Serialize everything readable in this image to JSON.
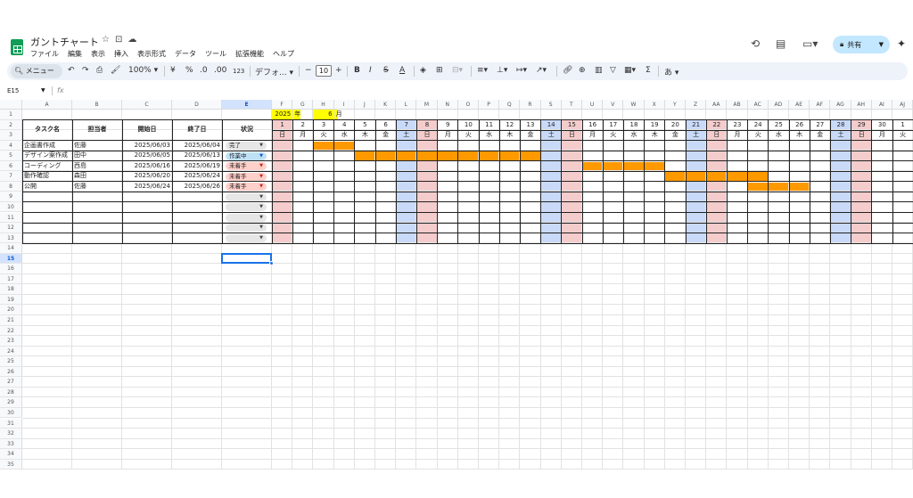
{
  "app": {
    "title": "ガントチャート",
    "menus": [
      "ファイル",
      "編集",
      "表示",
      "挿入",
      "表示形式",
      "データ",
      "ツール",
      "拡張機能",
      "ヘルプ"
    ],
    "share_label": "共有"
  },
  "toolbar": {
    "search_label": "メニュー",
    "zoom": "100%",
    "currency": "¥",
    "percent": "%",
    "dec_decrease": ".0",
    "dec_increase": ".00",
    "number_format": "123",
    "font": "デフォ...",
    "font_size": "10",
    "ime_label": "あ"
  },
  "formula_bar": {
    "name_box": "E15",
    "fx": "fx"
  },
  "columns": [
    "A",
    "B",
    "C",
    "D",
    "E",
    "F",
    "G",
    "H",
    "I",
    "J",
    "K",
    "L",
    "M",
    "N",
    "O",
    "P",
    "Q",
    "R",
    "S",
    "T",
    "U",
    "V",
    "W",
    "X",
    "Y",
    "Z",
    "AA",
    "AB",
    "AC",
    "AD",
    "AE",
    "AF",
    "AG",
    "AH",
    "AI",
    "AJ"
  ],
  "rows_count": 35,
  "selected": {
    "column": "E",
    "row": 15
  },
  "year_row": {
    "year": "2025",
    "year_label": "年",
    "month": "6",
    "month_label": "月"
  },
  "headers": {
    "task": "タスク名",
    "owner": "担当者",
    "start": "開始日",
    "end": "終了日",
    "status": "状況"
  },
  "days": [
    "1",
    "2",
    "3",
    "4",
    "5",
    "6",
    "7",
    "8",
    "9",
    "10",
    "11",
    "12",
    "13",
    "14",
    "15",
    "16",
    "17",
    "18",
    "19",
    "20",
    "21",
    "22",
    "23",
    "24",
    "25",
    "26",
    "27",
    "28",
    "29",
    "30",
    "1"
  ],
  "weekdays": [
    "日",
    "月",
    "火",
    "水",
    "木",
    "金",
    "土",
    "日",
    "月",
    "火",
    "水",
    "木",
    "金",
    "土",
    "日",
    "月",
    "火",
    "水",
    "木",
    "金",
    "土",
    "日",
    "月",
    "火",
    "水",
    "木",
    "金",
    "土",
    "日",
    "月",
    "火"
  ],
  "tasks": [
    {
      "name": "企画書作成",
      "owner": "佐藤",
      "start": "2025/06/03",
      "end": "2025/06/04",
      "status": "完了",
      "status_kind": "done",
      "bar_start_day": 3,
      "bar_end_day": 4
    },
    {
      "name": "デザイン案作成",
      "owner": "田中",
      "start": "2025/06/05",
      "end": "2025/06/13",
      "status": "作業中",
      "status_kind": "progress",
      "bar_start_day": 5,
      "bar_end_day": 13
    },
    {
      "name": "コーディング",
      "owner": "西島",
      "start": "2025/06/16",
      "end": "2025/06/19",
      "status": "未着手",
      "status_kind": "todo",
      "bar_start_day": 16,
      "bar_end_day": 19
    },
    {
      "name": "動作確認",
      "owner": "森田",
      "start": "2025/06/20",
      "end": "2025/06/24",
      "status": "未着手",
      "status_kind": "todo",
      "bar_start_day": 20,
      "bar_end_day": 24
    },
    {
      "name": "公開",
      "owner": "佐藤",
      "start": "2025/06/24",
      "end": "2025/06/26",
      "status": "未着手",
      "status_kind": "todo",
      "bar_start_day": 24,
      "bar_end_day": 26
    }
  ],
  "empty_task_rows": 5,
  "colors": {
    "saturday": "#c9daf8",
    "sunday": "#f4cccc",
    "bar": "#ff9900",
    "year_highlight": "#ffff00",
    "chip_done": "#e6e6e6",
    "chip_progress": "#bfe1f6",
    "chip_todo": "#ffcfc9",
    "chip_empty": "#e6e6e6"
  }
}
